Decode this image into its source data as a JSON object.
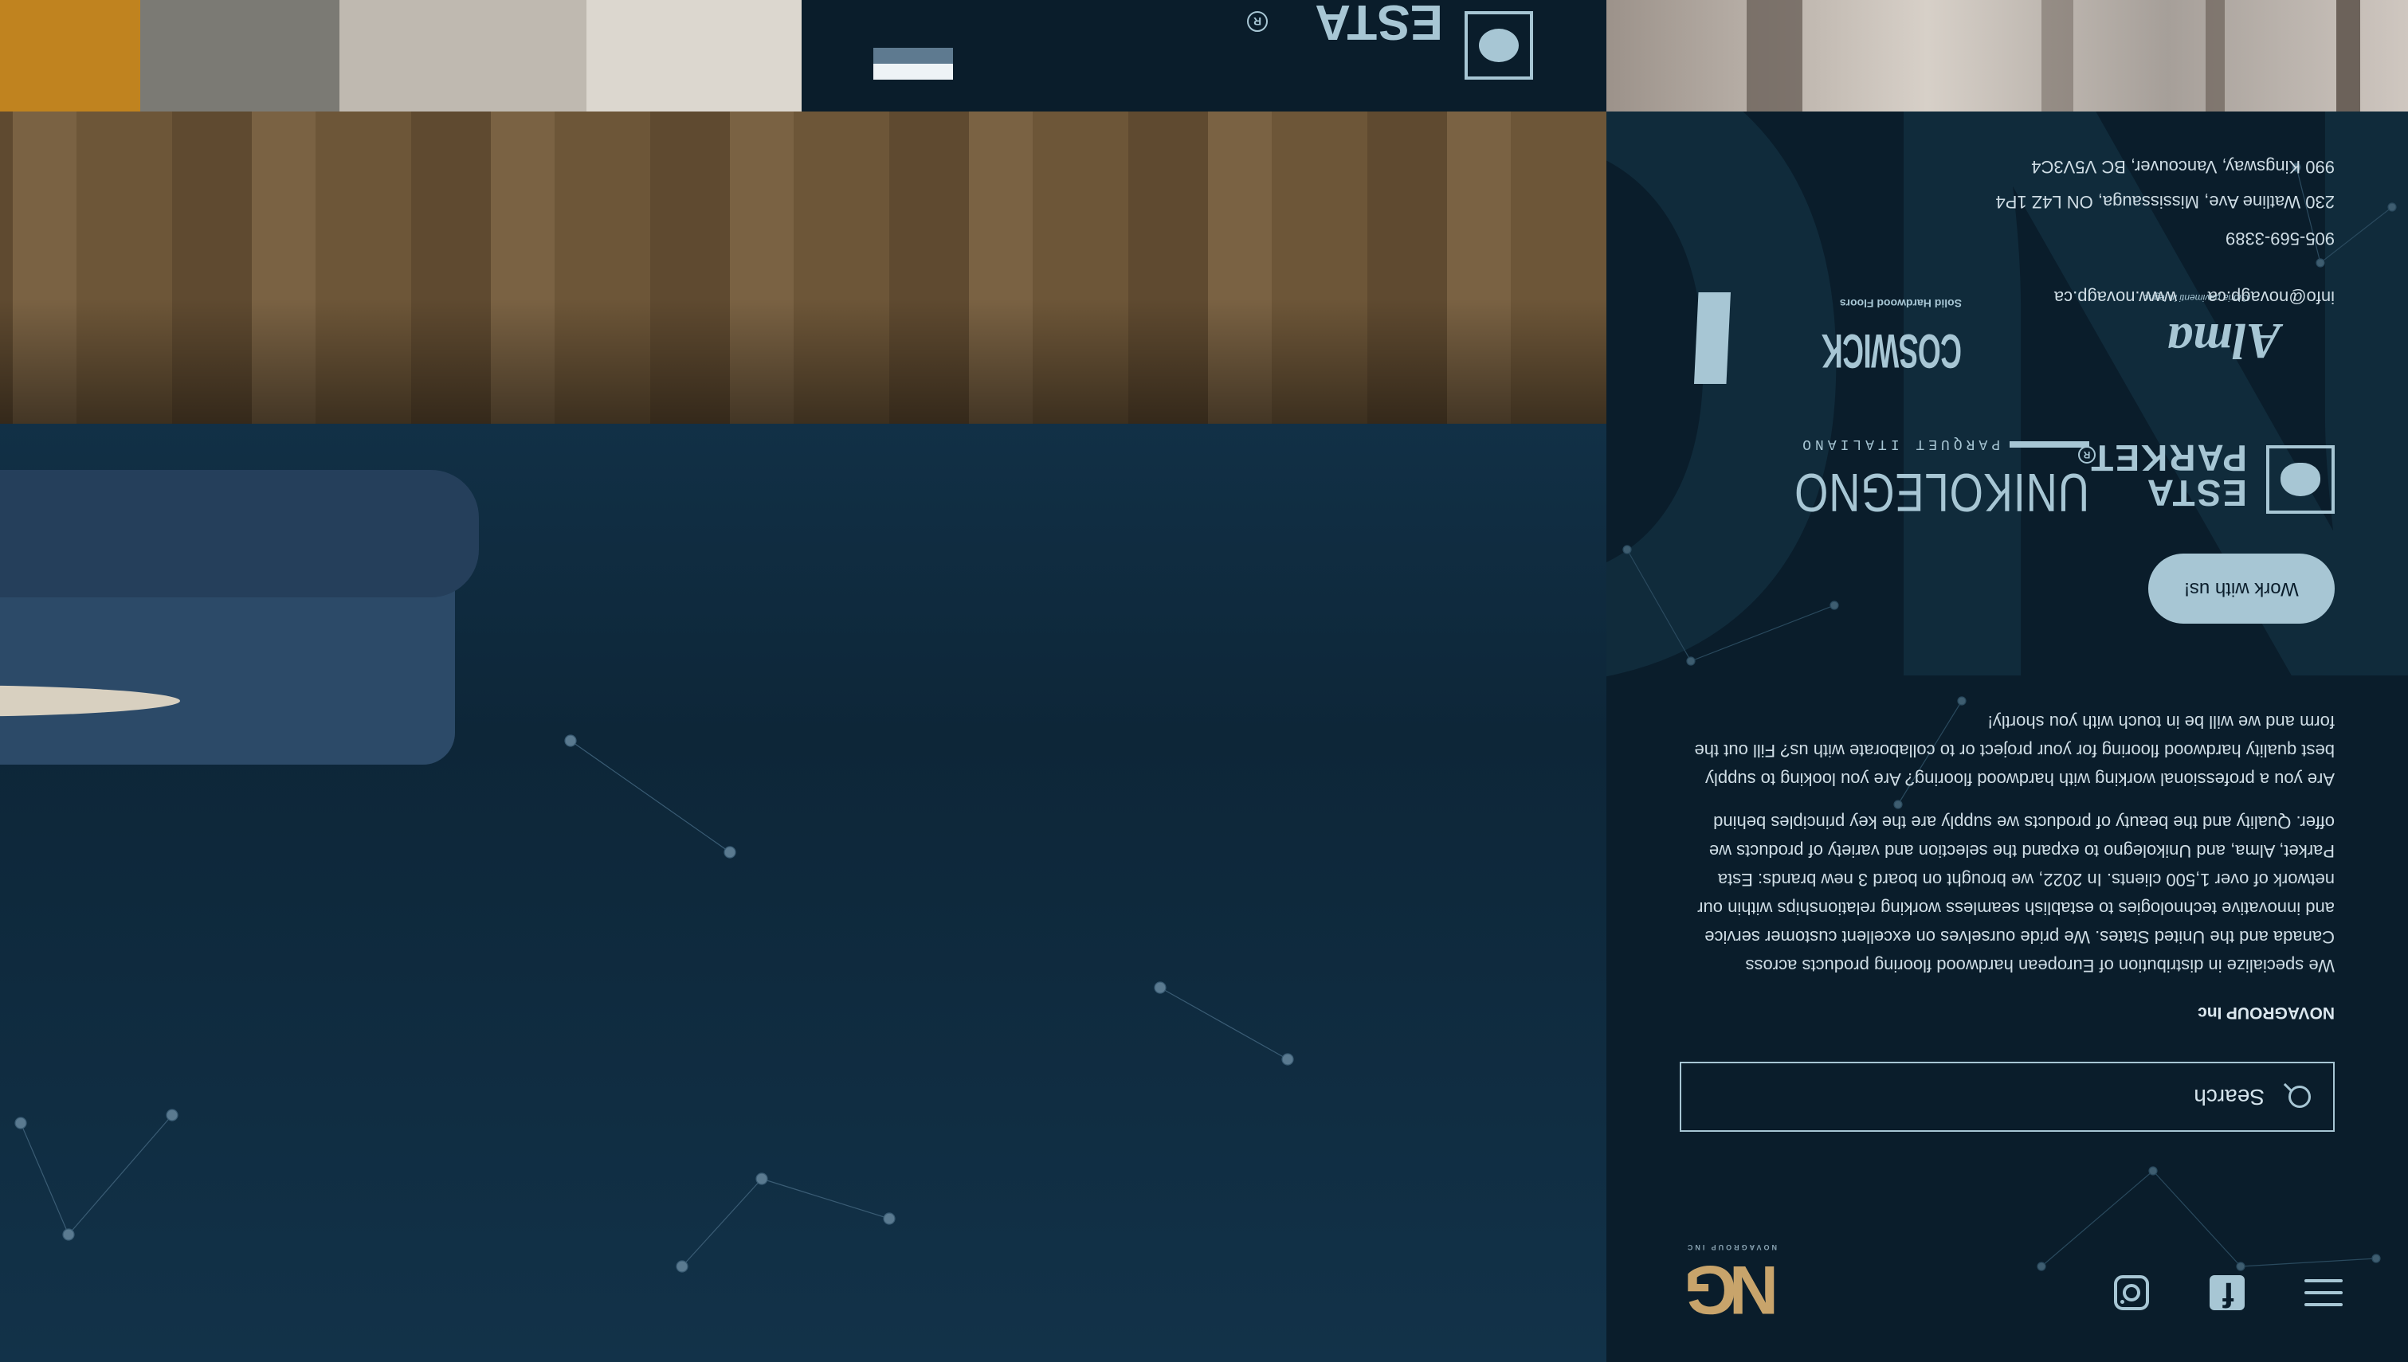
{
  "colors": {
    "panel_bg": "#0a1d2b",
    "accent": "#a7c6d4",
    "logo_gold": "#c8a46b"
  },
  "header": {
    "logo_text": "NG",
    "logo_subtitle": "NOVAGROUP INC",
    "icons": [
      "menu-icon",
      "facebook-icon",
      "instagram-icon"
    ]
  },
  "search": {
    "placeholder": "Search"
  },
  "company": {
    "title": "NOVAGROUP Inc",
    "paragraph1": "We specialize in distribution of European hardwood flooring products across Canada and the United States. We pride ourselves on excellent customer service and innovative technologies to establish seamless working relationships within our network of over 1,500 clients. In 2022, we brought on board 3 new brands: Esta Parket, Alma, and Unikolegno to expand the selection and variety of products we offer. Quality and the beauty of products we supply are the key principles behind",
    "paragraph2": "Are you a professional working with hardwood flooring? Are you looking to supply best quality hardwood flooring for your project or to collaborate with us? Fill out the form and we will be in touch with you shortly!",
    "cta_label": "Work with us!"
  },
  "brands": {
    "esta": {
      "line1": "ESTA",
      "line2": "PARKET",
      "reg": "R"
    },
    "unikolegno": {
      "name": "UNIKOLEGNO",
      "sub": "PARQUET ITALIANO"
    },
    "alma": {
      "name": "Alma",
      "sub": "Gioria pavimenti in legno"
    },
    "coswick": {
      "name": "COSWICK",
      "sub": "Solid Hardwood Floors"
    }
  },
  "contact": {
    "email": "info@novagp.ca",
    "website": "www.novagp.ca",
    "phone": "905-569-3389",
    "address1": "230 Watline Ave, Mississauga, ON L4Z 1P4",
    "address2": "990 Kingsway, Vancouver, BC V5V3C4"
  },
  "tiles": {
    "esta_logo_text": "ESTA",
    "reg": "R"
  }
}
